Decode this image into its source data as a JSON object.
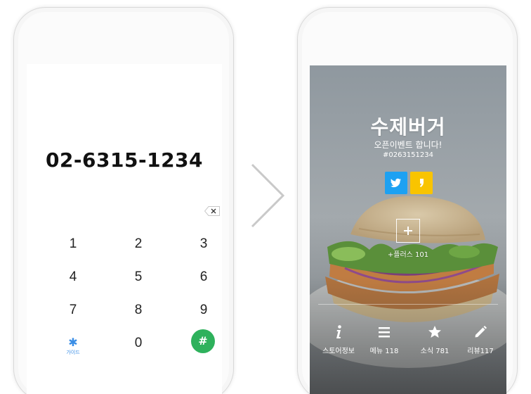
{
  "dialer": {
    "number": "02-6315-1234",
    "keys": [
      "1",
      "2",
      "3",
      "4",
      "5",
      "6",
      "7",
      "8",
      "9"
    ],
    "star_key": {
      "glyph": "✱",
      "label": "가이드",
      "icon": "asterisk-icon"
    },
    "zero_key": "0",
    "hash_key": "#",
    "backspace_icon": "backspace-icon",
    "colors": {
      "hash": "#2eb15c",
      "star": "#3a8ee6"
    }
  },
  "store": {
    "title": "수제버거",
    "subtitle": "오픈이벤트 합니다!",
    "tag": "#0263151234",
    "share": [
      {
        "name": "twitter",
        "icon": "twitter-icon",
        "color": "#1da1f2"
      },
      {
        "name": "kakao",
        "icon": "quote-icon",
        "color": "#f9c400"
      }
    ],
    "plus_label": "+플러스 101",
    "tabs": [
      {
        "icon": "info-icon",
        "label": "스토어정보"
      },
      {
        "icon": "menu-icon",
        "label": "메뉴 118"
      },
      {
        "icon": "star-icon",
        "label": "소식 781"
      },
      {
        "icon": "pencil-icon",
        "label": "리뷰117"
      }
    ]
  }
}
